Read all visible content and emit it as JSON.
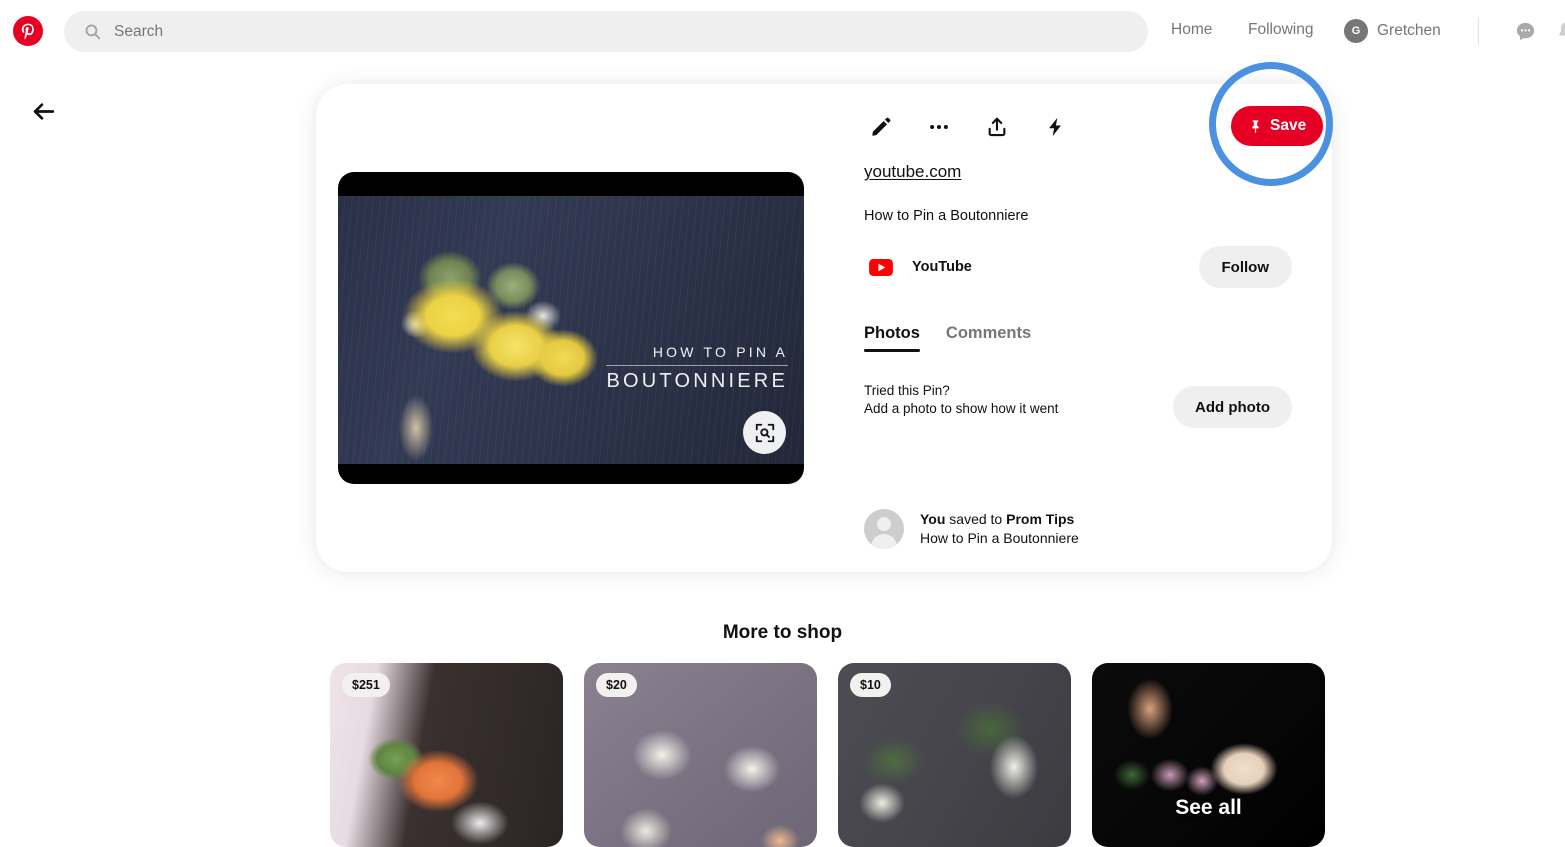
{
  "header": {
    "logo_icon": "pinterest-logo-icon",
    "search": {
      "icon": "search-icon",
      "placeholder": "Search",
      "value": ""
    },
    "nav": {
      "home": "Home",
      "following": "Following"
    },
    "account": {
      "initial": "G",
      "name": "Gretchen"
    },
    "messages_icon": "messages-icon",
    "notifications_icon": "bell-icon"
  },
  "back_button": {
    "icon": "arrow-left-icon"
  },
  "closeup": {
    "actions": [
      {
        "icon": "pencil-icon",
        "name": "edit-pin-button"
      },
      {
        "icon": "ellipsis-icon",
        "name": "more-options-button"
      },
      {
        "icon": "share-icon",
        "name": "share-button"
      },
      {
        "icon": "lightning-bolt-icon",
        "name": "promote-button"
      }
    ],
    "save_button": {
      "label": "Save",
      "icon": "pushpin-icon",
      "color": "#e60023"
    },
    "highlight_ring_color": "#4b91e2",
    "source_link": "youtube.com",
    "pin_title": "How to Pin a Boutonniere",
    "media": {
      "overlay_line1": "HOW TO PIN A",
      "overlay_line2": "BOUTONNIERE",
      "visual_search_icon": "visual-search-icon"
    },
    "creator": {
      "icon": "youtube-icon",
      "name": "YouTube",
      "follow_label": "Follow"
    },
    "tabs": [
      {
        "label": "Photos",
        "active": true
      },
      {
        "label": "Comments",
        "active": false
      }
    ],
    "tried": {
      "line1": "Tried this Pin?",
      "line2": "Add a photo to show how it went",
      "button_label": "Add photo"
    },
    "saved": {
      "prefix": "You",
      "middle": " saved to ",
      "board": "Prom Tips",
      "pin_name": "How to Pin a Boutonniere"
    }
  },
  "shop": {
    "title": "More to shop",
    "cards": [
      {
        "price": "$251",
        "name": "shop-card-1"
      },
      {
        "price": "$20",
        "name": "shop-card-2"
      },
      {
        "price": "$10",
        "name": "shop-card-3"
      },
      {
        "price": "",
        "name": "shop-card-see-all",
        "see_all_label": "See all"
      }
    ]
  }
}
